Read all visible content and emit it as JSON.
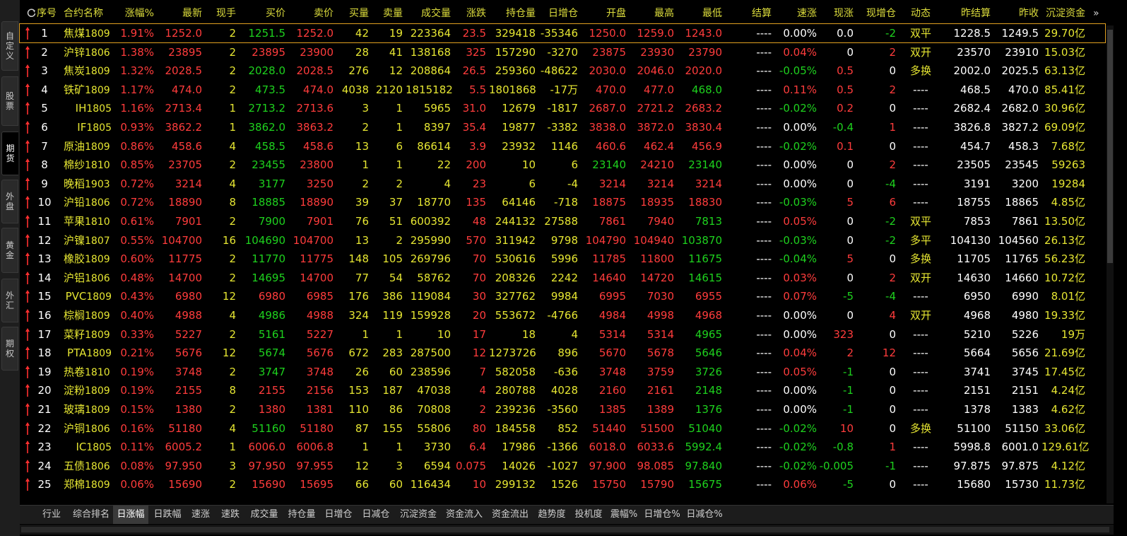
{
  "colors": {
    "up": "#ff3c3c",
    "down": "#1ed21e",
    "neutral": "#ffffff",
    "yellow": "#e6e632",
    "header": "#dcdc3c"
  },
  "left_tabs": [
    {
      "label": "自定义",
      "active": false
    },
    {
      "label": "股票",
      "active": false
    },
    {
      "label": "期货",
      "active": true
    },
    {
      "label": "外盘",
      "active": false
    },
    {
      "label": "黄金",
      "active": false
    },
    {
      "label": "外汇",
      "active": false
    },
    {
      "label": "期权",
      "active": false
    }
  ],
  "refresh_icon": "refresh-icon",
  "more_columns_glyph": "»",
  "headers": [
    "序号",
    "合约名称",
    "涨幅%",
    "最新",
    "现手",
    "买价",
    "卖价",
    "买量",
    "卖量",
    "成交量",
    "涨跌",
    "持仓量",
    "日增仓",
    "开盘",
    "最高",
    "最低",
    "结算",
    "速涨",
    "现涨",
    "现增仓",
    "动态",
    "昨结算",
    "昨收",
    "沉淀资金"
  ],
  "rows": [
    {
      "no": "1",
      "name": "焦煤",
      "code": "1809",
      "pct": "1.91%",
      "last": "1252.0",
      "hand": "2",
      "bid": "1251.5",
      "ask": "1252.0",
      "bidv": "42",
      "askv": "19",
      "vol": "223364",
      "chg": "23.5",
      "oi": "329418",
      "oichg": "-35346",
      "open": "1250.0",
      "high": "1259.0",
      "low": "1243.0",
      "settle": "----",
      "spd": "0.00%",
      "nowchg": "0.0",
      "nowoi": "-2",
      "dyn": "双平",
      "presettle": "1228.5",
      "preclose": "1249.5",
      "fund": "29.70亿",
      "selected": true
    },
    {
      "no": "2",
      "name": "沪锌",
      "code": "1806",
      "pct": "1.38%",
      "last": "23895",
      "hand": "2",
      "bid": "23895",
      "ask": "23900",
      "bidv": "28",
      "askv": "41",
      "vol": "138168",
      "chg": "325",
      "oi": "157290",
      "oichg": "-3270",
      "open": "23875",
      "high": "23930",
      "low": "23790",
      "settle": "----",
      "spd": "0.04%",
      "nowchg": "0",
      "nowoi": "2",
      "dyn": "双开",
      "presettle": "23570",
      "preclose": "23910",
      "fund": "15.03亿"
    },
    {
      "no": "3",
      "name": "焦炭",
      "code": "1809",
      "pct": "1.32%",
      "last": "2028.5",
      "hand": "2",
      "bid": "2028.0",
      "ask": "2028.5",
      "bidv": "276",
      "askv": "12",
      "vol": "208864",
      "chg": "26.5",
      "oi": "259360",
      "oichg": "-48622",
      "open": "2030.0",
      "high": "2046.0",
      "low": "2020.0",
      "settle": "----",
      "spd": "-0.05%",
      "nowchg": "0.5",
      "nowoi": "0",
      "dyn": "多换",
      "presettle": "2002.0",
      "preclose": "2025.5",
      "fund": "63.13亿"
    },
    {
      "no": "4",
      "name": "铁矿",
      "code": "1809",
      "pct": "1.17%",
      "last": "474.0",
      "hand": "2",
      "bid": "473.5",
      "ask": "474.0",
      "bidv": "4038",
      "askv": "2120",
      "vol": "1815182",
      "chg": "5.5",
      "oi": "1801868",
      "oichg": "-17万",
      "open": "470.0",
      "high": "477.0",
      "low": "468.0",
      "settle": "----",
      "spd": "0.11%",
      "nowchg": "0.5",
      "nowoi": "2",
      "dyn": "----",
      "presettle": "468.5",
      "preclose": "470.0",
      "fund": "85.41亿"
    },
    {
      "no": "5",
      "name": "IH",
      "code": "1805",
      "pct": "1.16%",
      "last": "2713.4",
      "hand": "1",
      "bid": "2713.2",
      "ask": "2713.6",
      "bidv": "3",
      "askv": "1",
      "vol": "5965",
      "chg": "31.0",
      "oi": "12679",
      "oichg": "-1817",
      "open": "2687.0",
      "high": "2721.2",
      "low": "2683.2",
      "settle": "----",
      "spd": "-0.02%",
      "nowchg": "0.2",
      "nowoi": "0",
      "dyn": "----",
      "presettle": "2682.4",
      "preclose": "2682.0",
      "fund": "30.96亿"
    },
    {
      "no": "6",
      "name": "IF",
      "code": "1805",
      "pct": "0.93%",
      "last": "3862.2",
      "hand": "1",
      "bid": "3862.0",
      "ask": "3863.2",
      "bidv": "2",
      "askv": "1",
      "vol": "8397",
      "chg": "35.4",
      "oi": "19877",
      "oichg": "-3382",
      "open": "3838.0",
      "high": "3872.0",
      "low": "3830.4",
      "settle": "----",
      "spd": "0.00%",
      "nowchg": "-0.4",
      "nowoi": "1",
      "dyn": "----",
      "presettle": "3826.8",
      "preclose": "3827.2",
      "fund": "69.09亿"
    },
    {
      "no": "7",
      "name": "原油",
      "code": "1809",
      "pct": "0.86%",
      "last": "458.6",
      "hand": "4",
      "bid": "458.5",
      "ask": "458.6",
      "bidv": "13",
      "askv": "6",
      "vol": "86614",
      "chg": "3.9",
      "oi": "23932",
      "oichg": "1146",
      "open": "460.6",
      "high": "462.4",
      "low": "456.9",
      "settle": "----",
      "spd": "-0.02%",
      "nowchg": "0.1",
      "nowoi": "0",
      "dyn": "----",
      "presettle": "454.7",
      "preclose": "458.3",
      "fund": "7.68亿"
    },
    {
      "no": "8",
      "name": "棉纱",
      "code": "1810",
      "pct": "0.85%",
      "last": "23705",
      "hand": "2",
      "bid": "23455",
      "ask": "23800",
      "bidv": "1",
      "askv": "1",
      "vol": "22",
      "chg": "200",
      "oi": "10",
      "oichg": "6",
      "open": "23140",
      "high": "24210",
      "low": "23140",
      "settle": "----",
      "spd": "0.00%",
      "nowchg": "0",
      "nowoi": "2",
      "dyn": "----",
      "presettle": "23505",
      "preclose": "23545",
      "fund": "59263"
    },
    {
      "no": "9",
      "name": "晚稻",
      "code": "1903",
      "pct": "0.72%",
      "last": "3214",
      "hand": "4",
      "bid": "3177",
      "ask": "3250",
      "bidv": "2",
      "askv": "2",
      "vol": "4",
      "chg": "23",
      "oi": "6",
      "oichg": "-4",
      "open": "3214",
      "high": "3214",
      "low": "3214",
      "settle": "----",
      "spd": "0.00%",
      "nowchg": "0",
      "nowoi": "-4",
      "dyn": "----",
      "presettle": "3191",
      "preclose": "3200",
      "fund": "19284"
    },
    {
      "no": "10",
      "name": "沪铅",
      "code": "1806",
      "pct": "0.72%",
      "last": "18890",
      "hand": "8",
      "bid": "18885",
      "ask": "18890",
      "bidv": "39",
      "askv": "37",
      "vol": "18770",
      "chg": "135",
      "oi": "64146",
      "oichg": "-718",
      "open": "18875",
      "high": "18935",
      "low": "18830",
      "settle": "----",
      "spd": "-0.03%",
      "nowchg": "5",
      "nowoi": "6",
      "dyn": "----",
      "presettle": "18755",
      "preclose": "18865",
      "fund": "4.85亿"
    },
    {
      "no": "11",
      "name": "苹果",
      "code": "1810",
      "pct": "0.61%",
      "last": "7901",
      "hand": "2",
      "bid": "7900",
      "ask": "7901",
      "bidv": "76",
      "askv": "51",
      "vol": "600392",
      "chg": "48",
      "oi": "244132",
      "oichg": "27588",
      "open": "7861",
      "high": "7940",
      "low": "7813",
      "settle": "----",
      "spd": "0.05%",
      "nowchg": "0",
      "nowoi": "-2",
      "dyn": "双平",
      "presettle": "7853",
      "preclose": "7861",
      "fund": "13.50亿"
    },
    {
      "no": "12",
      "name": "沪镍",
      "code": "1807",
      "pct": "0.55%",
      "last": "104700",
      "hand": "16",
      "bid": "104690",
      "ask": "104700",
      "bidv": "13",
      "askv": "2",
      "vol": "295990",
      "chg": "570",
      "oi": "311942",
      "oichg": "9798",
      "open": "104790",
      "high": "104940",
      "low": "103870",
      "settle": "----",
      "spd": "-0.03%",
      "nowchg": "0",
      "nowoi": "-2",
      "dyn": "多平",
      "presettle": "104130",
      "preclose": "104560",
      "fund": "26.13亿"
    },
    {
      "no": "13",
      "name": "橡胶",
      "code": "1809",
      "pct": "0.60%",
      "last": "11775",
      "hand": "2",
      "bid": "11770",
      "ask": "11775",
      "bidv": "148",
      "askv": "105",
      "vol": "269796",
      "chg": "70",
      "oi": "530616",
      "oichg": "5996",
      "open": "11785",
      "high": "11800",
      "low": "11675",
      "settle": "----",
      "spd": "-0.04%",
      "nowchg": "5",
      "nowoi": "0",
      "dyn": "多换",
      "presettle": "11705",
      "preclose": "11765",
      "fund": "56.23亿"
    },
    {
      "no": "14",
      "name": "沪铝",
      "code": "1806",
      "pct": "0.48%",
      "last": "14700",
      "hand": "2",
      "bid": "14695",
      "ask": "14700",
      "bidv": "77",
      "askv": "54",
      "vol": "58762",
      "chg": "70",
      "oi": "208326",
      "oichg": "2242",
      "open": "14640",
      "high": "14720",
      "low": "14615",
      "settle": "----",
      "spd": "0.03%",
      "nowchg": "0",
      "nowoi": "2",
      "dyn": "双开",
      "presettle": "14630",
      "preclose": "14660",
      "fund": "10.72亿"
    },
    {
      "no": "15",
      "name": "PVC",
      "code": "1809",
      "pct": "0.43%",
      "last": "6980",
      "hand": "12",
      "bid": "6980",
      "ask": "6985",
      "bidv": "176",
      "askv": "386",
      "vol": "119084",
      "chg": "30",
      "oi": "327762",
      "oichg": "9984",
      "open": "6995",
      "high": "7030",
      "low": "6955",
      "settle": "----",
      "spd": "0.07%",
      "nowchg": "-5",
      "nowoi": "-4",
      "dyn": "----",
      "presettle": "6950",
      "preclose": "6990",
      "fund": "8.01亿"
    },
    {
      "no": "16",
      "name": "棕榈",
      "code": "1809",
      "pct": "0.40%",
      "last": "4988",
      "hand": "4",
      "bid": "4986",
      "ask": "4988",
      "bidv": "324",
      "askv": "119",
      "vol": "159928",
      "chg": "20",
      "oi": "553672",
      "oichg": "-4766",
      "open": "4984",
      "high": "4998",
      "low": "4968",
      "settle": "----",
      "spd": "0.00%",
      "nowchg": "0",
      "nowoi": "4",
      "dyn": "双开",
      "presettle": "4968",
      "preclose": "4980",
      "fund": "19.33亿"
    },
    {
      "no": "17",
      "name": "菜籽",
      "code": "1809",
      "pct": "0.33%",
      "last": "5227",
      "hand": "2",
      "bid": "5161",
      "ask": "5227",
      "bidv": "1",
      "askv": "1",
      "vol": "10",
      "chg": "17",
      "oi": "18",
      "oichg": "4",
      "open": "5314",
      "high": "5314",
      "low": "4965",
      "settle": "----",
      "spd": "0.00%",
      "nowchg": "323",
      "nowoi": "0",
      "dyn": "----",
      "presettle": "5210",
      "preclose": "5226",
      "fund": "19万"
    },
    {
      "no": "18",
      "name": "PTA",
      "code": "1809",
      "pct": "0.21%",
      "last": "5676",
      "hand": "12",
      "bid": "5674",
      "ask": "5676",
      "bidv": "672",
      "askv": "283",
      "vol": "287500",
      "chg": "12",
      "oi": "1273726",
      "oichg": "896",
      "open": "5670",
      "high": "5678",
      "low": "5646",
      "settle": "----",
      "spd": "0.04%",
      "nowchg": "2",
      "nowoi": "12",
      "dyn": "----",
      "presettle": "5664",
      "preclose": "5656",
      "fund": "21.69亿"
    },
    {
      "no": "19",
      "name": "热卷",
      "code": "1810",
      "pct": "0.19%",
      "last": "3748",
      "hand": "2",
      "bid": "3747",
      "ask": "3748",
      "bidv": "26",
      "askv": "60",
      "vol": "238596",
      "chg": "7",
      "oi": "582058",
      "oichg": "-636",
      "open": "3748",
      "high": "3759",
      "low": "3726",
      "settle": "----",
      "spd": "0.05%",
      "nowchg": "-1",
      "nowoi": "0",
      "dyn": "----",
      "presettle": "3741",
      "preclose": "3745",
      "fund": "17.45亿"
    },
    {
      "no": "20",
      "name": "淀粉",
      "code": "1809",
      "pct": "0.19%",
      "last": "2155",
      "hand": "8",
      "bid": "2155",
      "ask": "2156",
      "bidv": "153",
      "askv": "187",
      "vol": "47038",
      "chg": "4",
      "oi": "280788",
      "oichg": "4028",
      "open": "2160",
      "high": "2161",
      "low": "2148",
      "settle": "----",
      "spd": "0.00%",
      "nowchg": "-1",
      "nowoi": "0",
      "dyn": "----",
      "presettle": "2151",
      "preclose": "2151",
      "fund": "4.24亿"
    },
    {
      "no": "21",
      "name": "玻璃",
      "code": "1809",
      "pct": "0.15%",
      "last": "1380",
      "hand": "2",
      "bid": "1380",
      "ask": "1381",
      "bidv": "110",
      "askv": "86",
      "vol": "70808",
      "chg": "2",
      "oi": "239236",
      "oichg": "-3560",
      "open": "1385",
      "high": "1389",
      "low": "1376",
      "settle": "----",
      "spd": "0.00%",
      "nowchg": "-1",
      "nowoi": "0",
      "dyn": "----",
      "presettle": "1378",
      "preclose": "1383",
      "fund": "4.62亿"
    },
    {
      "no": "22",
      "name": "沪铜",
      "code": "1806",
      "pct": "0.16%",
      "last": "51180",
      "hand": "4",
      "bid": "51160",
      "ask": "51180",
      "bidv": "87",
      "askv": "155",
      "vol": "55806",
      "chg": "80",
      "oi": "184558",
      "oichg": "852",
      "open": "51440",
      "high": "51500",
      "low": "51040",
      "settle": "----",
      "spd": "-0.02%",
      "nowchg": "10",
      "nowoi": "0",
      "dyn": "多换",
      "presettle": "51100",
      "preclose": "51150",
      "fund": "33.06亿"
    },
    {
      "no": "23",
      "name": "IC",
      "code": "1805",
      "pct": "0.11%",
      "last": "6005.2",
      "hand": "1",
      "bid": "6006.0",
      "ask": "6006.8",
      "bidv": "1",
      "askv": "1",
      "vol": "3730",
      "chg": "6.4",
      "oi": "17986",
      "oichg": "-1366",
      "open": "6018.0",
      "high": "6033.6",
      "low": "5992.4",
      "settle": "----",
      "spd": "-0.02%",
      "nowchg": "-0.8",
      "nowoi": "1",
      "dyn": "----",
      "presettle": "5998.8",
      "preclose": "6001.0",
      "fund": "129.61亿"
    },
    {
      "no": "24",
      "name": "五债",
      "code": "1806",
      "pct": "0.08%",
      "last": "97.950",
      "hand": "3",
      "bid": "97.950",
      "ask": "97.955",
      "bidv": "12",
      "askv": "3",
      "vol": "6594",
      "chg": "0.075",
      "oi": "14026",
      "oichg": "-1027",
      "open": "97.900",
      "high": "98.085",
      "low": "97.840",
      "settle": "----",
      "spd": "-0.02%",
      "nowchg": "-0.005",
      "nowoi": "-1",
      "dyn": "----",
      "presettle": "97.875",
      "preclose": "97.875",
      "fund": "4.12亿"
    },
    {
      "no": "25",
      "name": "郑棉",
      "code": "1809",
      "pct": "0.06%",
      "last": "15690",
      "hand": "2",
      "bid": "15690",
      "ask": "15695",
      "bidv": "66",
      "askv": "60",
      "vol": "116434",
      "chg": "10",
      "oi": "299132",
      "oichg": "1526",
      "open": "15750",
      "high": "15790",
      "low": "15675",
      "settle": "----",
      "spd": "0.06%",
      "nowchg": "-5",
      "nowoi": "0",
      "dyn": "----",
      "presettle": "15680",
      "preclose": "15730",
      "fund": "11.73亿"
    }
  ],
  "bottom_tabs": [
    {
      "label": "行业",
      "active": false
    },
    {
      "label": "综合排名",
      "active": false
    },
    {
      "label": "日涨幅",
      "active": true
    },
    {
      "label": "日跌幅",
      "active": false
    },
    {
      "label": "速涨",
      "active": false
    },
    {
      "label": "速跌",
      "active": false
    },
    {
      "label": "成交量",
      "active": false
    },
    {
      "label": "持仓量",
      "active": false
    },
    {
      "label": "日增仓",
      "active": false
    },
    {
      "label": "日减仓",
      "active": false
    },
    {
      "label": "沉淀资金",
      "active": false
    },
    {
      "label": "资金流入",
      "active": false
    },
    {
      "label": "资金流出",
      "active": false
    },
    {
      "label": "趋势度",
      "active": false
    },
    {
      "label": "投机度",
      "active": false
    },
    {
      "label": "震幅%",
      "active": false
    },
    {
      "label": "日增仓%",
      "active": false
    },
    {
      "label": "日减仓%",
      "active": false
    }
  ]
}
